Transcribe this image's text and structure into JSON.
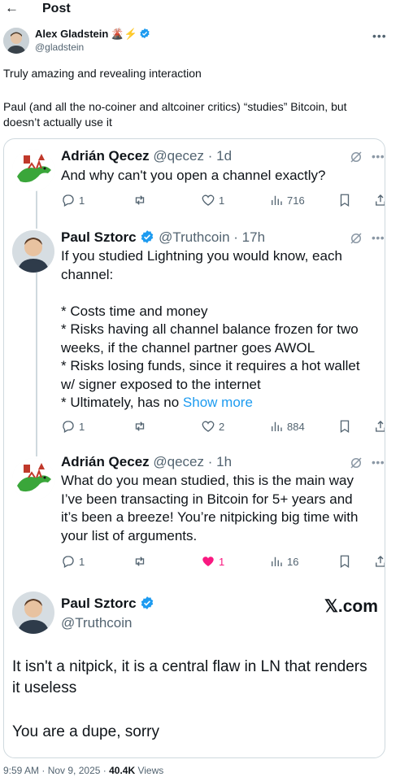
{
  "header": {
    "back_icon": "back-arrow-icon",
    "title": "Post"
  },
  "author": {
    "name": "Alex Gladstein",
    "emoji": "🌋⚡",
    "handle": "@gladstein",
    "verified_color": "#1d9bf0"
  },
  "post": {
    "text_line1": "Truly amazing and revealing interaction",
    "text_line2a": "Paul (and all the no-coiner and altcoiner critics) “studies” Bitcoin, but",
    "text_line2b": "doesn’t actually use it"
  },
  "screenshot": {
    "replies": [
      {
        "name": "Adrián Qecez",
        "meta": "@qecez · 1d",
        "lines": [
          "And why can't you open a channel exactly?"
        ],
        "replies": "1",
        "retweets": "",
        "likes": "1",
        "views": "716"
      },
      {
        "name": "Paul Sztorc",
        "meta": "@Truthcoin · 17h",
        "lines": [
          "If you studied Lightning you would know, each",
          "channel:",
          "",
          "* Costs time and money",
          "* Risks having all channel balance frozen for two",
          "weeks, if the channel partner goes AWOL",
          "* Risks losing funds, since it requires a hot wallet",
          "w/ signer exposed to the internet",
          "* Ultimately, has no "
        ],
        "show_more": "Show more",
        "replies": "1",
        "retweets": "",
        "likes": "2",
        "views": "884"
      },
      {
        "name": "Adrián Qecez",
        "meta": "@qecez · 1h",
        "lines": [
          "What do you mean studied, this is the main way",
          "I’ve been transacting in Bitcoin for 5+ years and",
          "it’s been a breeze! You’re nitpicking big time with",
          "your list of arguments."
        ],
        "replies": "1",
        "retweets": "",
        "likes": "1",
        "views": "16"
      }
    ],
    "final": {
      "name": "Paul Sztorc",
      "handle": "@Truthcoin",
      "brand": "𝕏.com",
      "text1": "It isn't a nitpick, it is a central flaw in LN that renders",
      "text2": "it useless",
      "text3": "You are a dupe, sorry"
    }
  },
  "footer": {
    "time": "9:59 AM",
    "sep1": " · ",
    "date": "Nov 9, 2025",
    "sep2": " · ",
    "views": "40.4K",
    "views_label": " Views"
  },
  "colors": {
    "accent": "#1d9bf0",
    "like": "#f91880",
    "muted": "#536471",
    "border": "#cfd9de"
  }
}
